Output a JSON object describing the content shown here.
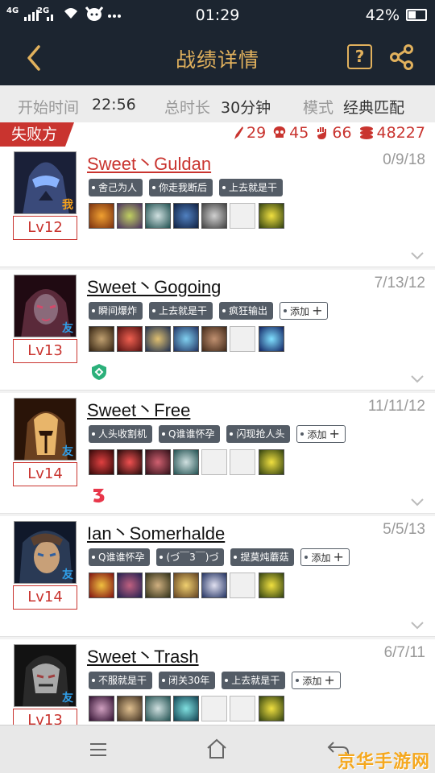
{
  "status_bar": {
    "network_1": "4G",
    "network_2": "2G",
    "time": "01:29",
    "battery": "42%"
  },
  "nav": {
    "title": "战绩详情",
    "help_label": "?"
  },
  "info": {
    "start_label": "开始时间",
    "start_value": "22:56",
    "duration_label": "总时长",
    "duration_value": "30分钟",
    "mode_label": "模式",
    "mode_value": "经典匹配"
  },
  "team": {
    "label": "失败方",
    "kills": "29",
    "deaths": "45",
    "assists": "66",
    "gold": "48227"
  },
  "players": [
    {
      "name": "Sweet丶Guldan",
      "kda": "0/9/18",
      "level": "Lv12",
      "badge": "我",
      "tags": [
        "舍己为人",
        "你走我断后",
        "上去就是干"
      ],
      "add_label": "",
      "colors": {
        "face": "#3a4a7a",
        "accent": "#8ab4ff"
      }
    },
    {
      "name": "Sweet丶Gogoing",
      "kda": "7/13/12",
      "level": "Lv13",
      "badge": "友",
      "tags": [
        "瞬间爆炸",
        "上去就是干",
        "疯狂输出"
      ],
      "add_label": "添加",
      "colors": {
        "face": "#5a2a3a",
        "accent": "#d14a6b"
      }
    },
    {
      "name": "Sweet丶Free",
      "kda": "11/11/12",
      "level": "Lv14",
      "badge": "友",
      "tags": [
        "人头收割机",
        "Q谁谁怀孕",
        "闪现抢人头"
      ],
      "add_label": "添加",
      "colors": {
        "face": "#6a4020",
        "accent": "#e8b56a"
      }
    },
    {
      "name": "Ian丶Somerhalde",
      "kda": "5/5/13",
      "level": "Lv14",
      "badge": "友",
      "tags": [
        "Q谁谁怀孕",
        "(づ￣3￣)づ",
        "提莫炖蘑菇"
      ],
      "add_label": "添加",
      "colors": {
        "face": "#2a3a55",
        "accent": "#c8a078"
      }
    },
    {
      "name": "Sweet丶Trash",
      "kda": "6/7/11",
      "level": "Lv13",
      "badge": "友",
      "tags": [
        "不服就是干",
        "闭关30年",
        "上去就是干"
      ],
      "add_label": "添加",
      "colors": {
        "face": "#2a2a2a",
        "accent": "#a04040"
      }
    }
  ],
  "watermark": "京华手游网"
}
